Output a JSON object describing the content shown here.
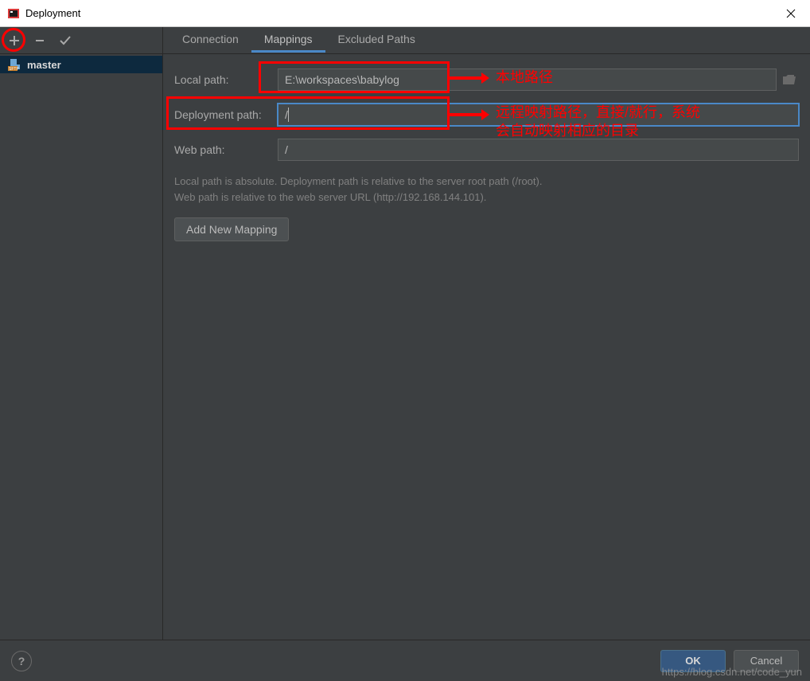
{
  "window": {
    "title": "Deployment"
  },
  "toolbar": {
    "add": "+",
    "remove": "−",
    "default": "✓"
  },
  "servers": [
    {
      "name": "master",
      "type": "SFTP"
    }
  ],
  "tabs": {
    "connection": "Connection",
    "mappings": "Mappings",
    "excluded": "Excluded Paths",
    "active": "mappings"
  },
  "form": {
    "local_path_label": "Local path:",
    "local_path_value": "E:\\workspaces\\babylog",
    "deployment_path_label": "Deployment path:",
    "deployment_path_value": "/",
    "web_path_label": "Web path:",
    "web_path_value": "/",
    "help1": "Local path is absolute. Deployment path is relative to the server root path (/root).",
    "help2": "Web path is relative to the web server URL (http://192.168.144.101).",
    "add_mapping": "Add New Mapping"
  },
  "buttons": {
    "ok": "OK",
    "cancel": "Cancel"
  },
  "annotations": {
    "local": "本地路径",
    "deploy_line1": "远程映射路径，直接/就行，系统",
    "deploy_line2": "会自动映射相应的目录"
  },
  "watermark": "https://blog.csdn.net/code_yun"
}
